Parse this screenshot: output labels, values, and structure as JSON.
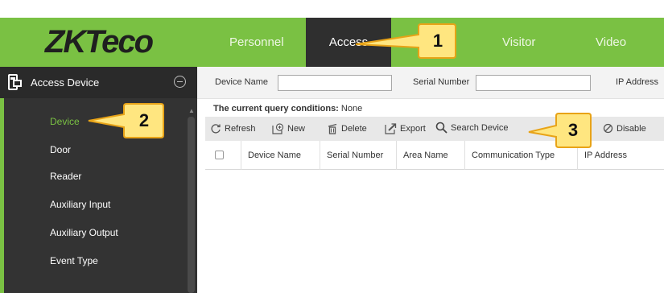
{
  "brand": {
    "logo_text": "ZKTeco"
  },
  "nav": {
    "tabs": [
      {
        "label": "Personnel",
        "active": false
      },
      {
        "label": "Access",
        "active": true
      },
      {
        "label": "Visitor",
        "active": false
      },
      {
        "label": "Video",
        "active": false
      }
    ]
  },
  "sidebar": {
    "header": "Access Device",
    "items": [
      {
        "label": "Device",
        "active": true
      },
      {
        "label": "Door",
        "active": false
      },
      {
        "label": "Reader",
        "active": false
      },
      {
        "label": "Auxiliary Input",
        "active": false
      },
      {
        "label": "Auxiliary Output",
        "active": false
      },
      {
        "label": "Event Type",
        "active": false
      }
    ]
  },
  "query": {
    "device_name_label": "Device Name",
    "device_name_value": "",
    "serial_number_label": "Serial Number",
    "serial_number_value": "",
    "ip_address_label": "IP Address",
    "conditions_prefix": "The current query conditions:",
    "conditions_value": "None"
  },
  "toolbar": {
    "refresh": "Refresh",
    "new": "New",
    "delete": "Delete",
    "export": "Export",
    "search_device": "Search Device",
    "disable": "Disable"
  },
  "table": {
    "columns": [
      "Device Name",
      "Serial Number",
      "Area Name",
      "Communication Type",
      "IP Address"
    ],
    "rows": []
  },
  "callouts": [
    "1",
    "2",
    "3"
  ],
  "colors": {
    "brand_green": "#7ac143",
    "active_tab": "#2f2f2f",
    "sidebar_bg": "#333333",
    "callout_fill": "#ffe680",
    "callout_stroke": "#e8a317"
  }
}
